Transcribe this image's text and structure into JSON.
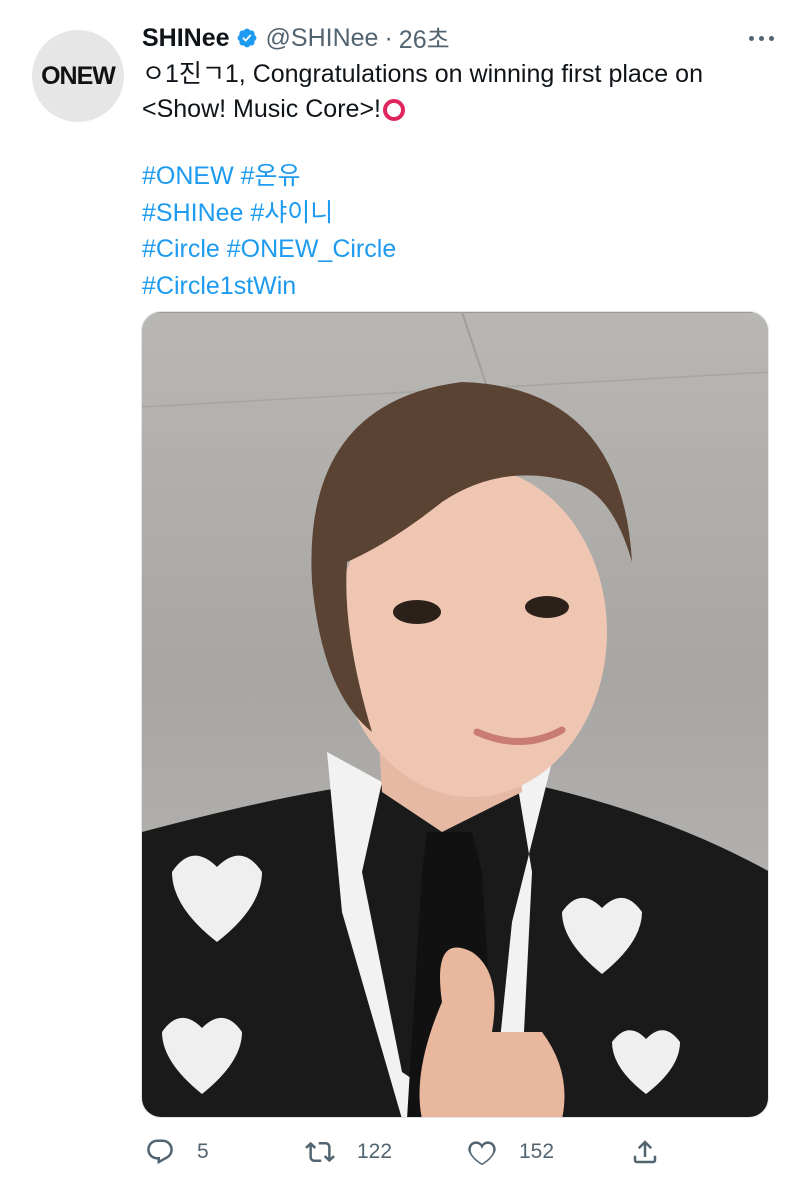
{
  "tweet": {
    "avatar_text": "ONEW",
    "name": "SHINee",
    "handle": "@SHINee",
    "separator": "·",
    "time": "26초",
    "text_line1": "ㅇ1진ㄱ1, Congratulations on winning first place on",
    "text_line2": "<Show! Music Core>!",
    "hashtags": [
      [
        "#ONEW",
        "#온유"
      ],
      [
        "#SHINee",
        "#샤이니"
      ],
      [
        "#Circle",
        "#ONEW_Circle"
      ],
      [
        "#Circle1stWin"
      ]
    ],
    "photo_alt": "selfie photo"
  },
  "actions": {
    "reply_count": "5",
    "retweet_count": "122",
    "like_count": "152",
    "icons": [
      "reply-icon",
      "retweet-icon",
      "like-icon",
      "share-icon"
    ]
  },
  "colors": {
    "link": "#1d9bf0",
    "verified": "#1d9bf0",
    "secondary_text": "#536471",
    "emoji_red": "#e0245e"
  }
}
